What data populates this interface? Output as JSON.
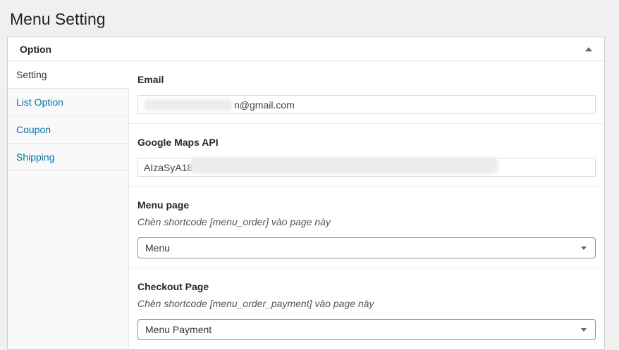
{
  "page": {
    "title": "Menu Setting"
  },
  "panel": {
    "title": "Option",
    "collapse_icon": "up-triangle"
  },
  "tabs": [
    {
      "label": "Setting",
      "active": true
    },
    {
      "label": "List Option",
      "active": false
    },
    {
      "label": "Coupon",
      "active": false
    },
    {
      "label": "Shipping",
      "active": false
    }
  ],
  "form": {
    "email": {
      "label": "Email",
      "value_visible": "n@gmail.com",
      "value_prefix_redacted": true
    },
    "google_maps_api": {
      "label": "Google Maps API",
      "value_visible": "AIzaSyA18",
      "value_suffix_redacted": true
    },
    "menu_page": {
      "label": "Menu page",
      "description": "Chèn shortcode [menu_order] vào page này",
      "selected": "Menu"
    },
    "checkout_page": {
      "label": "Checkout Page",
      "description": "Chèn shortcode [menu_order_payment] vào page này",
      "selected": "Menu Payment"
    }
  },
  "colors": {
    "page_background": "#f0f0f1",
    "panel_border": "#ccd0d4",
    "tab_link": "#0073aa",
    "heading_text": "#23282d",
    "description_text": "#50575e",
    "select_border": "#8c8f94",
    "select_arrow": "#6c5a7d"
  }
}
